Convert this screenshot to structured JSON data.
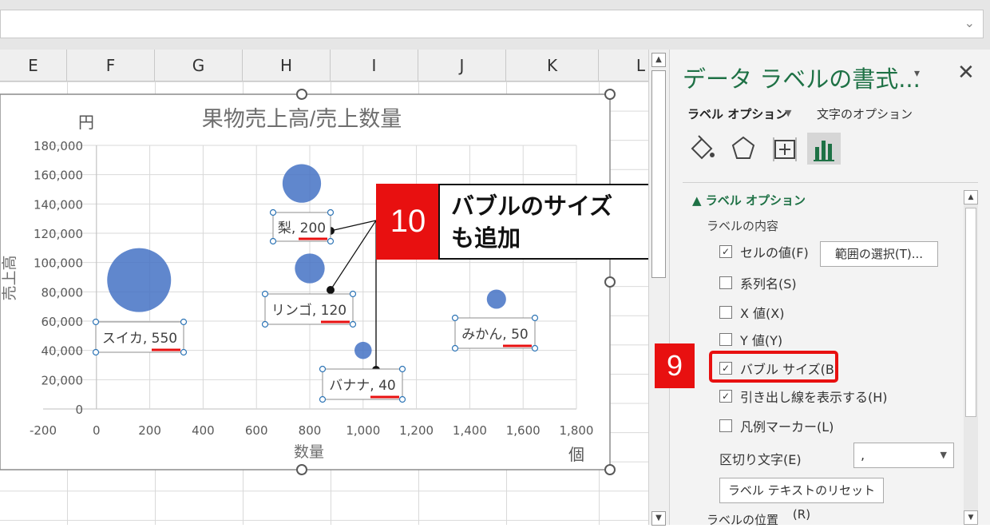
{
  "formula_bar": {
    "value": "",
    "dropdown_icon": "chevron-down-icon"
  },
  "columns": [
    "E",
    "F",
    "G",
    "H",
    "I",
    "J",
    "K",
    "L"
  ],
  "chart_data": {
    "type": "scatter",
    "title": "果物売上高/売上数量",
    "xlabel": "数量",
    "ylabel": "売上高",
    "y_unit_label": "円",
    "x_unit_label": "個",
    "xlim": [
      -200,
      1800
    ],
    "ylim": [
      0,
      180000
    ],
    "x_ticks": [
      "-200",
      "0",
      "200",
      "400",
      "600",
      "800",
      "1,000",
      "1,200",
      "1,400",
      "1,600",
      "1,800"
    ],
    "y_ticks": [
      "0",
      "20,000",
      "40,000",
      "60,000",
      "80,000",
      "100,000",
      "120,000",
      "140,000",
      "160,000",
      "180,000"
    ],
    "grid": true,
    "bubble_color": "#4472c4",
    "points": [
      {
        "name": "スイカ",
        "x": 160,
        "y": 88000,
        "size": 550,
        "label": "スイカ, 550"
      },
      {
        "name": "梨",
        "x": 770,
        "y": 154000,
        "size": 200,
        "label": "梨, 200"
      },
      {
        "name": "リンゴ",
        "x": 800,
        "y": 96000,
        "size": 120,
        "label": "リンゴ, 120"
      },
      {
        "name": "バナナ",
        "x": 1000,
        "y": 40000,
        "size": 40,
        "label": "バナナ, 40"
      },
      {
        "name": "みかん",
        "x": 1500,
        "y": 75000,
        "size": 50,
        "label": "みかん, 50"
      }
    ]
  },
  "annotations": {
    "step10_number": "10",
    "step10_line1": "バブルのサイズ",
    "step10_line2": "も追加",
    "step9_number": "9",
    "accent_color": "#e81010"
  },
  "pane": {
    "title": "データ ラベルの書式...",
    "dropdown_icon": "▾",
    "close_icon": "✕",
    "tab_label_options": "ラベル オプション",
    "tab_text_options": "文字のオプション",
    "section_title": "ラベル オプション",
    "section_sub": "ラベルの内容",
    "options": [
      {
        "label": "セルの値(F)",
        "checked": true
      },
      {
        "label": "系列名(S)",
        "checked": false
      },
      {
        "label": "X 値(X)",
        "checked": false
      },
      {
        "label": "Y 値(Y)",
        "checked": false
      },
      {
        "label": "バブル サイズ(B)",
        "checked": true
      },
      {
        "label": "引き出し線を表示する(H)",
        "checked": true
      },
      {
        "label": "凡例マーカー(L)",
        "checked": false
      }
    ],
    "range_button": "範囲の選択(T)...",
    "separator_label": "区切り文字(E)",
    "separator_value": ",",
    "reset_button": "ラベル テキストのリセット(R)",
    "position_label": "ラベルの位置"
  }
}
